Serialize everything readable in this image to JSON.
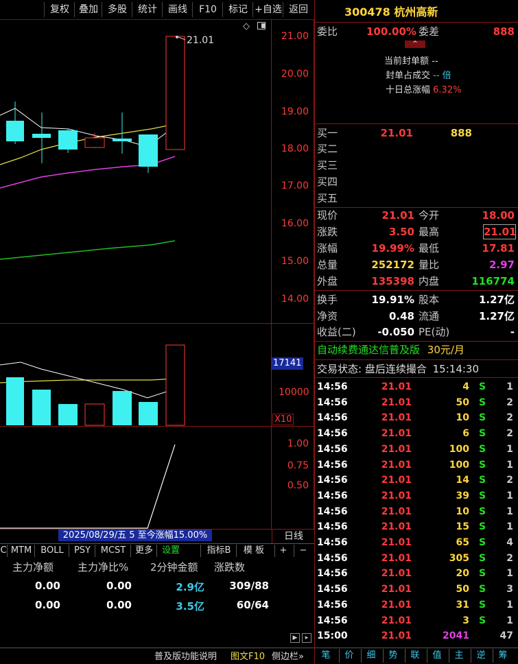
{
  "toolbar": {
    "items": [
      "复权",
      "叠加",
      "多股",
      "统计",
      "画线",
      "F10",
      "标记",
      "+自选",
      "返回"
    ]
  },
  "stock": {
    "code": "300478",
    "name": "杭州高新"
  },
  "order_ratio": {
    "label1": "委比",
    "value1": "100.00%",
    "label2": "委差",
    "value2": "888"
  },
  "seal_info": {
    "line1_label": "当前封单额",
    "line1_value": "--",
    "line2_label": "封单占成交",
    "line2_value": "-- 倍",
    "line3_label": "十日总涨幅",
    "line3_value": "6.32%"
  },
  "bids": [
    {
      "label": "买一",
      "price": "21.01",
      "vol": "888"
    },
    {
      "label": "买二",
      "price": "",
      "vol": ""
    },
    {
      "label": "买三",
      "price": "",
      "vol": ""
    },
    {
      "label": "买四",
      "price": "",
      "vol": ""
    },
    {
      "label": "买五",
      "price": "",
      "vol": ""
    }
  ],
  "quote": [
    {
      "l1": "现价",
      "v1": "21.01",
      "l2": "今开",
      "v2": "18.00"
    },
    {
      "l1": "涨跌",
      "v1": "3.50",
      "l2": "最高",
      "v2": "21.01"
    },
    {
      "l1": "涨幅",
      "v1": "19.99%",
      "l2": "最低",
      "v2": "17.81"
    },
    {
      "l1": "总量",
      "v1": "252172",
      "l2": "量比",
      "v2": "2.97"
    },
    {
      "l1": "外盘",
      "v1": "135398",
      "l2": "内盘",
      "v2": "116774"
    }
  ],
  "fundamentals": [
    {
      "l1": "换手",
      "v1": "19.91%",
      "l2": "股本",
      "v2": "1.27亿"
    },
    {
      "l1": "净资",
      "v1": "0.48",
      "l2": "流通",
      "v2": "1.27亿"
    },
    {
      "l1": "收益(二)",
      "v1": "-0.050",
      "l2": "PE(动)",
      "v2": "-"
    }
  ],
  "promo": {
    "text": "自动续费通达信普及版",
    "price": "30元/月"
  },
  "trade_status": {
    "label": "交易状态:",
    "value": "盘后连续撮合",
    "time": "15:14:30"
  },
  "ticks": [
    {
      "time": "14:56",
      "price": "21.01",
      "vol": "4",
      "bs": "S",
      "n": "1"
    },
    {
      "time": "14:56",
      "price": "21.01",
      "vol": "50",
      "bs": "S",
      "n": "2"
    },
    {
      "time": "14:56",
      "price": "21.01",
      "vol": "10",
      "bs": "S",
      "n": "2"
    },
    {
      "time": "14:56",
      "price": "21.01",
      "vol": "6",
      "bs": "S",
      "n": "2"
    },
    {
      "time": "14:56",
      "price": "21.01",
      "vol": "100",
      "bs": "S",
      "n": "1"
    },
    {
      "time": "14:56",
      "price": "21.01",
      "vol": "100",
      "bs": "S",
      "n": "1"
    },
    {
      "time": "14:56",
      "price": "21.01",
      "vol": "14",
      "bs": "S",
      "n": "2"
    },
    {
      "time": "14:56",
      "price": "21.01",
      "vol": "39",
      "bs": "S",
      "n": "1"
    },
    {
      "time": "14:56",
      "price": "21.01",
      "vol": "10",
      "bs": "S",
      "n": "1"
    },
    {
      "time": "14:56",
      "price": "21.01",
      "vol": "15",
      "bs": "S",
      "n": "1"
    },
    {
      "time": "14:56",
      "price": "21.01",
      "vol": "65",
      "bs": "S",
      "n": "4"
    },
    {
      "time": "14:56",
      "price": "21.01",
      "vol": "305",
      "bs": "S",
      "n": "2"
    },
    {
      "time": "14:56",
      "price": "21.01",
      "vol": "20",
      "bs": "S",
      "n": "1"
    },
    {
      "time": "14:56",
      "price": "21.01",
      "vol": "50",
      "bs": "S",
      "n": "3"
    },
    {
      "time": "14:56",
      "price": "21.01",
      "vol": "31",
      "bs": "S",
      "n": "1"
    },
    {
      "time": "14:56",
      "price": "21.01",
      "vol": "3",
      "bs": "S",
      "n": "1"
    },
    {
      "time": "15:00",
      "price": "21.01",
      "vol": "2041",
      "bs": "",
      "n": "47"
    }
  ],
  "price_axis": [
    "21.00",
    "20.00",
    "19.00",
    "18.00",
    "17.00",
    "16.00",
    "15.00",
    "14.00"
  ],
  "high_label": "21.01",
  "vol_axis": {
    "marker": "17141",
    "mid": "10000",
    "unit": "X10"
  },
  "ind_axis": [
    "1.00",
    "0.75",
    "0.50"
  ],
  "date_info": "2025/08/29/五 5 至今涨幅15.00%",
  "period": "日线",
  "ind_tabs": [
    "C",
    "MTM",
    "BOLL",
    "PSY",
    "MCST",
    "更多",
    "设置"
  ],
  "ind_tabs_right": [
    "指标B",
    "模 板",
    "+",
    "−"
  ],
  "flow": {
    "headers": [
      "主力净额",
      "主力净比%",
      "2分钟金额",
      "涨跌数"
    ],
    "rows": [
      [
        "0.00",
        "0.00",
        "2.9亿",
        "309/88"
      ],
      [
        "0.00",
        "0.00",
        "3.5亿",
        "60/64"
      ]
    ]
  },
  "footer": {
    "help": "普及版功能说明",
    "f10": "图文F10",
    "sidebar": "侧边栏»"
  },
  "right_tabs": [
    "笔",
    "价",
    "细",
    "势",
    "联",
    "值",
    "主",
    "逆",
    "筹"
  ],
  "colors": {
    "up": "#ff3a3a",
    "down": "#3ef0f0",
    "border": "#8a1515",
    "ma_yellow": "#e8e040",
    "ma_magenta": "#e040e0",
    "ma_green": "#20c020"
  }
}
